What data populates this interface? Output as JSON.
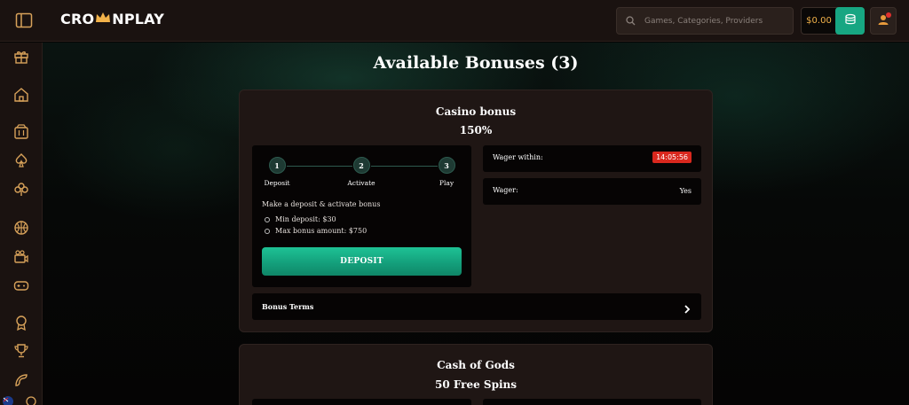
{
  "header": {
    "logo_left": "CRO",
    "logo_right": "NPLAY",
    "search_placeholder": "Games, Categories, Providers",
    "balance": "$0.00"
  },
  "sidebar": {
    "icons": [
      "gift-icon",
      "home-icon",
      "slot-machine-icon",
      "spade-icon",
      "clover-icon",
      "basketball-icon",
      "camera-icon",
      "gamepad-icon",
      "ribbon-icon",
      "trophy-icon",
      "boomerang-icon",
      "australia-flag-icon"
    ]
  },
  "main": {
    "title": "Available Bonuses (3)",
    "bonuses": [
      {
        "title": "Casino bonus",
        "subtitle": "150%",
        "steps": [
          {
            "number": "1",
            "label": "Deposit"
          },
          {
            "number": "2",
            "label": "Activate"
          },
          {
            "number": "3",
            "label": "Play"
          }
        ],
        "instruction": "Make a deposit & activate bonus",
        "requirements": [
          "Min deposit: $30",
          "Max bonus amount: $750"
        ],
        "deposit_label": "DEPOSIT",
        "wager_within_label": "Wager within:",
        "wager_within_value": "14:05:56",
        "wager_label": "Wager:",
        "wager_value": "Yes",
        "terms_label": "Bonus Terms"
      },
      {
        "title": "Cash of Gods",
        "subtitle": "50 Free Spins"
      }
    ]
  },
  "colors": {
    "accent_green": "#17a682",
    "balance_gold": "#f2b24a",
    "timer_red": "#d9281e",
    "card_bg": "#1f1614"
  }
}
